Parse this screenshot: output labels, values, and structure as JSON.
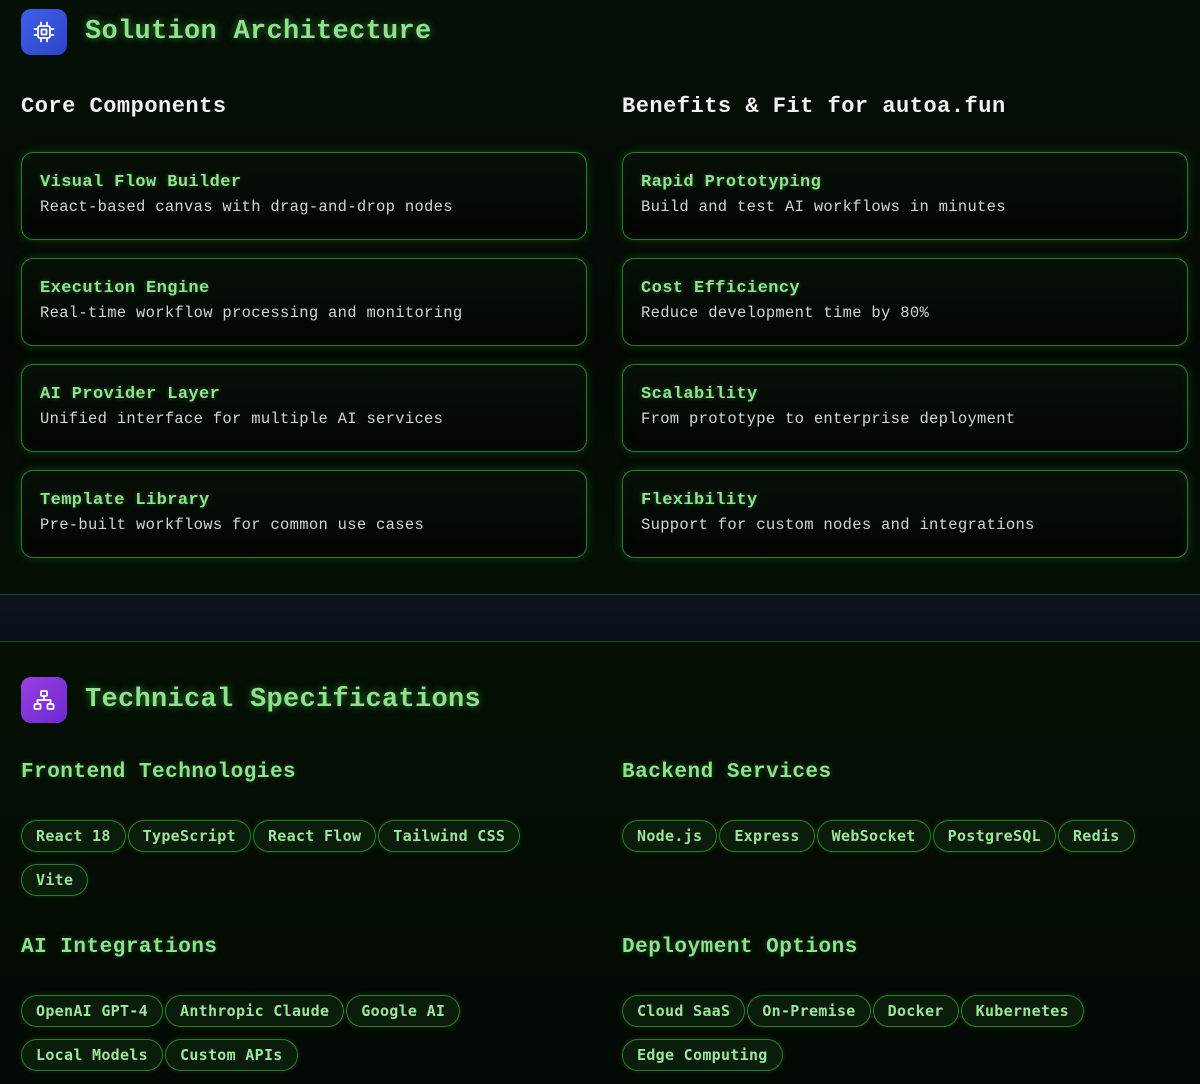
{
  "architecture": {
    "title": "Solution Architecture",
    "icon": "chip-icon",
    "core": {
      "heading": "Core Components",
      "items": [
        {
          "title": "Visual Flow Builder",
          "desc": "React-based canvas with drag-and-drop nodes"
        },
        {
          "title": "Execution Engine",
          "desc": "Real-time workflow processing and monitoring"
        },
        {
          "title": "AI Provider Layer",
          "desc": "Unified interface for multiple AI services"
        },
        {
          "title": "Template Library",
          "desc": "Pre-built workflows for common use cases"
        }
      ]
    },
    "benefits": {
      "heading": "Benefits & Fit for autoa.fun",
      "items": [
        {
          "title": "Rapid Prototyping",
          "desc": "Build and test AI workflows in minutes"
        },
        {
          "title": "Cost Efficiency",
          "desc": "Reduce development time by 80%"
        },
        {
          "title": "Scalability",
          "desc": "From prototype to enterprise deployment"
        },
        {
          "title": "Flexibility",
          "desc": "Support for custom nodes and integrations"
        }
      ]
    }
  },
  "specs": {
    "title": "Technical Specifications",
    "icon": "hierarchy-icon",
    "groups": [
      {
        "heading": "Frontend Technologies",
        "tags": [
          "React 18",
          "TypeScript",
          "React Flow",
          "Tailwind CSS",
          "Vite"
        ]
      },
      {
        "heading": "Backend Services",
        "tags": [
          "Node.js",
          "Express",
          "WebSocket",
          "PostgreSQL",
          "Redis"
        ]
      },
      {
        "heading": "AI Integrations",
        "tags": [
          "OpenAI GPT-4",
          "Anthropic Claude",
          "Google AI",
          "Local Models",
          "Custom APIs"
        ]
      },
      {
        "heading": "Deployment Options",
        "tags": [
          "Cloud SaaS",
          "On-Premise",
          "Docker",
          "Kubernetes",
          "Edge Computing"
        ]
      }
    ]
  },
  "colors": {
    "accent_green": "#8fe08f",
    "card_border": "#2f7a2f",
    "icon_blue": "#3f5fe8",
    "icon_purple": "#8a35dc"
  }
}
